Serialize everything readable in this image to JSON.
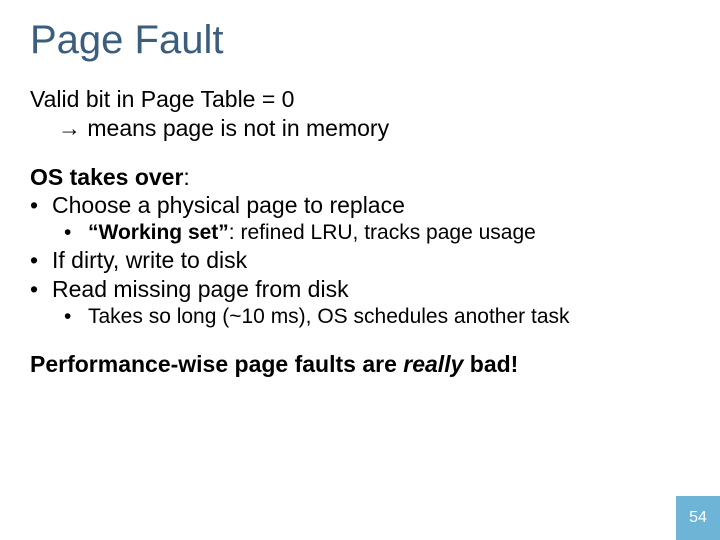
{
  "title": "Page Fault",
  "line1": "Valid bit in Page Table = 0",
  "line2_arrow": "→",
  "line2_text": " means page is not in memory",
  "os_takes_over": "OS takes over",
  "colon": ":",
  "bullet_choose": "Choose a physical page to replace",
  "sub_ws_quote_open": "“",
  "sub_ws_label": "Working set",
  "sub_ws_quote_close": "”",
  "sub_ws_rest": ": refined LRU, tracks page usage",
  "bullet_dirty": "If dirty, write to disk",
  "bullet_read": "Read missing page from disk",
  "sub_takes_long": "Takes so long (~10 ms), OS schedules another task",
  "perf_pre": "Performance-wise page faults are ",
  "perf_really": "really",
  "perf_post": " bad!",
  "page_number": "54"
}
